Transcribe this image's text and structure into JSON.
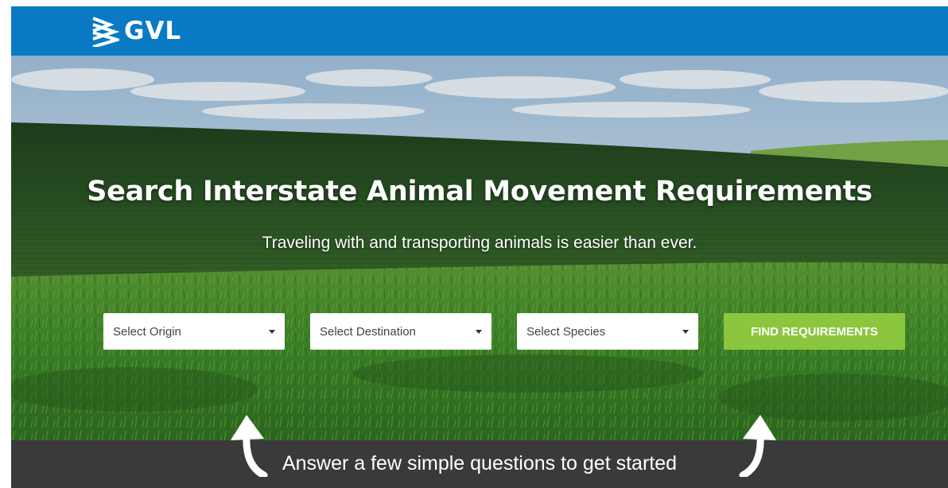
{
  "header": {
    "logo_text": "GVL",
    "logo_icon": "gvl-chevron-stack-icon",
    "background": "#0a7ac4"
  },
  "hero": {
    "title": "Search Interstate Animal Movement Requirements",
    "subtitle": "Traveling with and transporting animals is easier than ever.",
    "background_image": "green farm field under cloudy sky"
  },
  "search": {
    "origin": {
      "selected": "Select Origin"
    },
    "destination": {
      "selected": "Select Destination"
    },
    "species": {
      "selected": "Select Species"
    },
    "submit_label": "FIND REQUIREMENTS",
    "submit_color": "#8cc63f"
  },
  "footer_banner": {
    "text": "Answer a few simple questions to get started",
    "icons": [
      "curved-up-arrow-icon",
      "curved-up-arrow-icon"
    ],
    "background": "#3a3a3a"
  }
}
